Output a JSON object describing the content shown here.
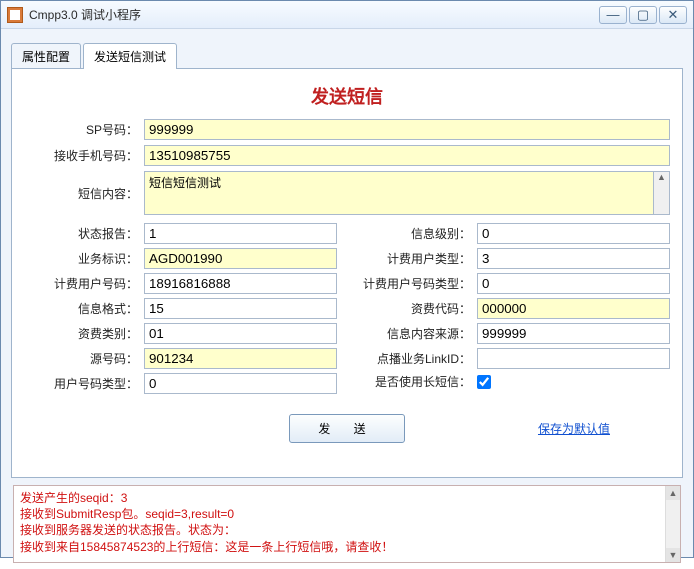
{
  "window": {
    "title": "Cmpp3.0 调试小程序"
  },
  "tabs": {
    "t0": "属性配置",
    "t1": "发送短信测试"
  },
  "heading": "发送短信",
  "labels": {
    "sp": "SP号码：",
    "phone": "接收手机号码：",
    "content": "短信内容：",
    "status": "状态报告：",
    "bizid": "业务标识：",
    "feeuser": "计费用户号码：",
    "fmt": "信息格式：",
    "feecat": "资费类别：",
    "srcnum": "源号码：",
    "usertype": "用户号码类型：",
    "msglvl": "信息级别：",
    "feeutype": "计费用户类型：",
    "feenumtype": "计费用户号码类型：",
    "feecode": "资费代码：",
    "infosrc": "信息内容来源：",
    "linkid": "点播业务LinkID：",
    "longsms": "是否使用长短信："
  },
  "values": {
    "sp": "999999",
    "phone": "13510985755",
    "content": "短信短信测试",
    "status": "1",
    "bizid": "AGD001990",
    "feeuser": "18916816888",
    "fmt": "15",
    "feecat": "01",
    "srcnum": "901234",
    "usertype": "0",
    "msglvl": "0",
    "feeutype": "3",
    "feenumtype": "0",
    "feecode": "000000",
    "infosrc": "999999",
    "linkid": ""
  },
  "buttons": {
    "send": "发  送",
    "save": "保存为默认值"
  },
  "log": {
    "l1": "发送产生的seqid：3",
    "l2": "接收到SubmitResp包。seqid=3,result=0",
    "l3": "接收到服务器发送的状态报告。状态为：",
    "l4": "接收到来自15845874523的上行短信：这是一条上行短信哦，请查收！"
  }
}
